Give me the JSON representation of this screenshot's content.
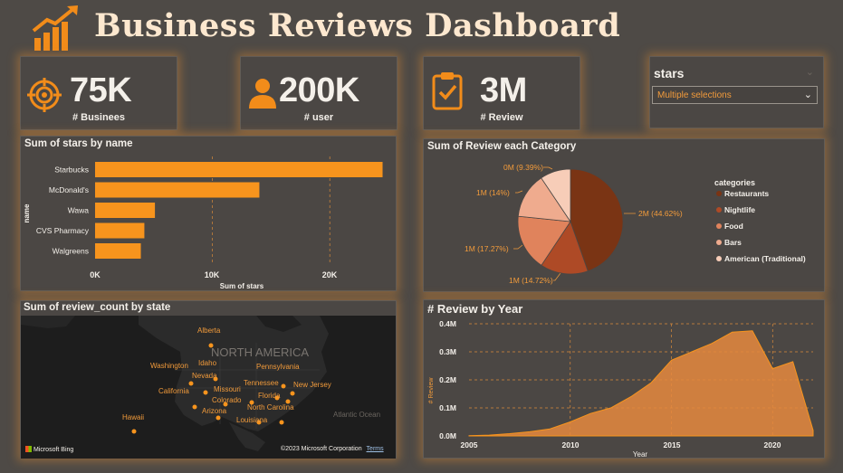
{
  "header": {
    "title": "Business Reviews Dashboard",
    "logo_icon": "bar-chart-growth-icon"
  },
  "kpis": [
    {
      "value": "75K",
      "label": "# Businees",
      "icon": "target-icon"
    },
    {
      "value": "200K",
      "label": "# user",
      "icon": "user-icon"
    },
    {
      "value": "3M",
      "label": "# Review",
      "icon": "clipboard-check-icon"
    }
  ],
  "slicer": {
    "title": "stars",
    "selected": "Multiple selections"
  },
  "colors": {
    "accent": "#f7941d",
    "background": "#4e4a46"
  },
  "bar_chart": {
    "title": "Sum of stars by name",
    "ylabel": "name",
    "xlabel": "Sum of stars",
    "ticks": [
      "0K",
      "10K",
      "20K"
    ]
  },
  "pie_chart": {
    "title": "Sum of Review each Category",
    "legend_title": "categories",
    "labels": [
      "2M (44.62%)",
      "1M (14.72%)",
      "1M (17.27%)",
      "1M (14%)",
      "0M (9.39%)"
    ]
  },
  "map": {
    "title": "Sum of review_count by state",
    "continent": "NORTH AMERICA",
    "ocean": "Atlantic Ocean",
    "states": [
      "Alberta",
      "Washington",
      "Idaho",
      "Nevada",
      "California",
      "Colorado",
      "Arizona",
      "Missouri",
      "Pennsylvania",
      "Tennessee",
      "New Jersey",
      "Florida",
      "North Carolina",
      "Louisiana",
      "Hawaii"
    ],
    "provider": "Microsoft Bing",
    "copyright": "©2023 Microsoft Corporation",
    "terms": "Terms"
  },
  "line_chart": {
    "title": "# Review by Year",
    "ylabel": "# Review",
    "xlabel": "Year",
    "yticks": [
      "0.0M",
      "0.1M",
      "0.2M",
      "0.3M",
      "0.4M"
    ],
    "xticks": [
      "2005",
      "2010",
      "2015",
      "2020"
    ]
  },
  "chart_data": [
    {
      "type": "bar",
      "title": "Sum of stars by name",
      "xlabel": "Sum of stars",
      "ylabel": "name",
      "categories": [
        "Starbucks",
        "McDonald's",
        "Wawa",
        "CVS Pharmacy",
        "Walgreens"
      ],
      "values": [
        24500,
        14000,
        5100,
        4200,
        3900
      ],
      "xlim": [
        0,
        25000
      ],
      "grid": true
    },
    {
      "type": "pie",
      "title": "Sum of Review each Category",
      "legend_title": "categories",
      "categories": [
        "Restaurants",
        "Nightlife",
        "Food",
        "Bars",
        "American (Traditional)"
      ],
      "values": [
        44.62,
        14.72,
        17.27,
        14,
        9.39
      ],
      "colors": [
        "#7a3414",
        "#ae4a26",
        "#e0835c",
        "#efab8e",
        "#f7cdb8"
      ],
      "legend_position": "right"
    },
    {
      "type": "area",
      "title": "# Review by Year",
      "xlabel": "Year",
      "ylabel": "# Review",
      "x": [
        2005,
        2006,
        2007,
        2008,
        2009,
        2010,
        2011,
        2012,
        2013,
        2014,
        2015,
        2016,
        2017,
        2018,
        2019,
        2020,
        2021,
        2022
      ],
      "y": [
        0.001,
        0.003,
        0.008,
        0.015,
        0.025,
        0.05,
        0.08,
        0.1,
        0.14,
        0.19,
        0.27,
        0.3,
        0.33,
        0.37,
        0.375,
        0.24,
        0.265,
        0.02
      ],
      "ylim": [
        0,
        0.4
      ],
      "xlim": [
        2005,
        2022
      ],
      "grid": true
    }
  ]
}
